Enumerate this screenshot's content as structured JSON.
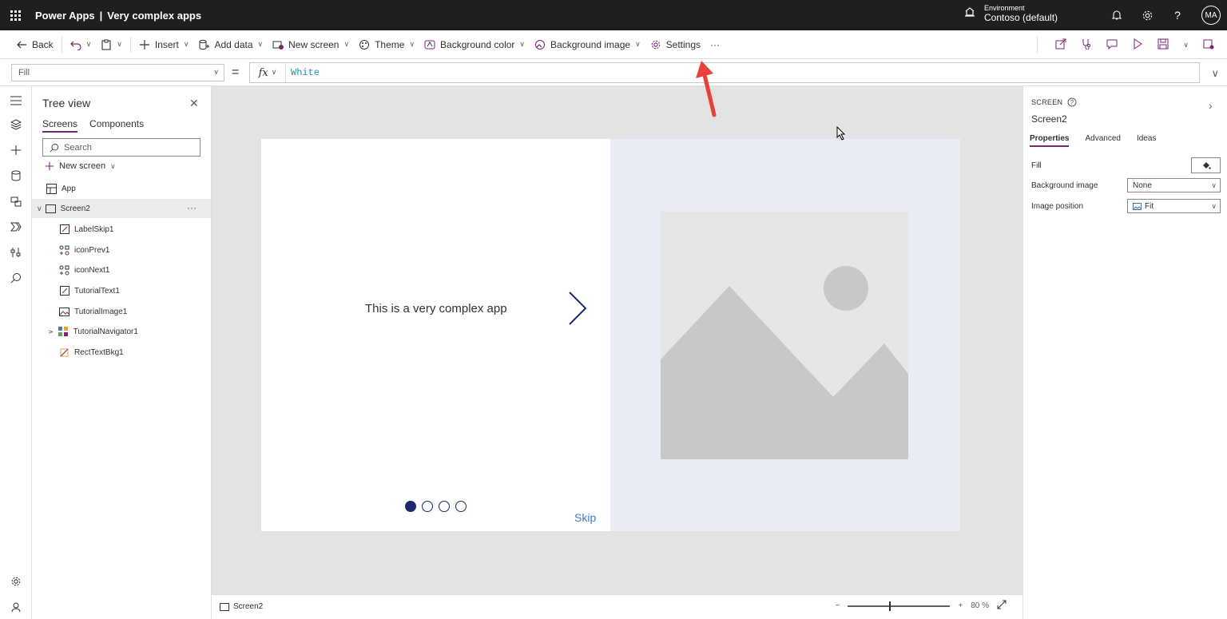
{
  "topbar": {
    "product": "Power Apps",
    "separator": "|",
    "app_name": "Very complex apps",
    "environment_label": "Environment",
    "environment_name": "Contoso (default)",
    "avatar_initials": "MA"
  },
  "commandbar": {
    "back": "Back",
    "insert": "Insert",
    "add_data": "Add data",
    "new_screen": "New screen",
    "theme": "Theme",
    "background_color": "Background color",
    "background_image": "Background image",
    "settings": "Settings",
    "more": "···"
  },
  "formula": {
    "property": "Fill",
    "equals": "=",
    "fx": "fx",
    "value": "White"
  },
  "tree": {
    "title": "Tree view",
    "tabs": [
      "Screens",
      "Components"
    ],
    "search_placeholder": "Search",
    "new_screen": "New screen",
    "app": "App",
    "screen": "Screen2",
    "more": "···",
    "items": [
      "LabelSkip1",
      "iconPrev1",
      "iconNext1",
      "TutorialText1",
      "TutorialImage1",
      "TutorialNavigator1",
      "RectTextBkg1"
    ]
  },
  "canvas": {
    "tutorial_text": "This is a very complex app",
    "skip": "Skip",
    "page_dots": 4,
    "active_dot": 1
  },
  "statusbar": {
    "screen": "Screen2",
    "zoom_minus": "−",
    "zoom_plus": "+",
    "zoom_value": "80",
    "zoom_unit": "%",
    "zoom_level": 0.4
  },
  "props": {
    "type": "SCREEN",
    "name": "Screen2",
    "tabs": [
      "Properties",
      "Advanced",
      "Ideas"
    ],
    "fill_label": "Fill",
    "bg_image_label": "Background image",
    "bg_image_value": "None",
    "image_position_label": "Image position",
    "image_position_value": "Fit"
  },
  "colors": {
    "topbar": "#201f1e",
    "accent": "#742774",
    "nav_dots": "#1a2a6c",
    "skip_link": "#3a7bc4",
    "formula_value": "#318fa0",
    "annotation_arrow": "#e8403a"
  },
  "icons": [
    "waffle-icon",
    "environment-icon",
    "bell-icon",
    "gear-icon",
    "help-icon",
    "undo-icon",
    "paste-icon",
    "plus-icon",
    "database-icon",
    "new-screen-icon",
    "palette-icon",
    "background-color-icon",
    "background-image-icon",
    "settings-icon",
    "share-icon",
    "app-checker-icon",
    "comment-icon",
    "play-icon",
    "save-icon",
    "publish-icon"
  ]
}
